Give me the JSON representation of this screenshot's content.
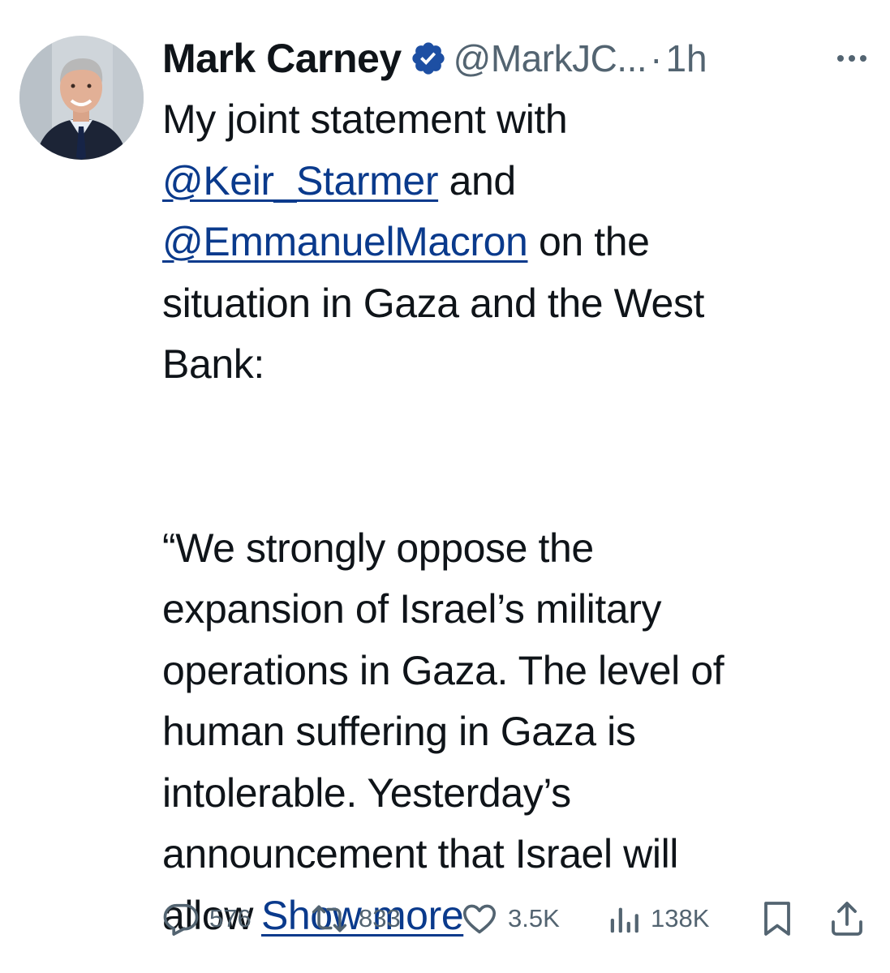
{
  "tweet": {
    "author": {
      "display_name": "Mark Carney",
      "handle": "@MarkJC...",
      "verified": true
    },
    "separator": "·",
    "time": "1h",
    "text": {
      "line1": "My joint statement with",
      "mention1": "@Keir_Starmer",
      "after_mention1": " and",
      "mention2": "@EmmanuelMacron",
      "after_mention2": " on the",
      "line4": "situation in Gaza and the West",
      "line5": "Bank:",
      "quote_lines": [
        "“We strongly oppose the",
        "expansion of Israel’s military",
        "operations in Gaza. The level of",
        "human suffering in Gaza is",
        "intolerable. Yesterday’s",
        "announcement that Israel will"
      ],
      "last_line_start": "allow",
      "show_more": "Show more"
    },
    "actions": {
      "replies": "576",
      "reposts": "833",
      "likes": "3.5K",
      "views": "138K"
    },
    "icons": {
      "verified": "verified-badge-icon",
      "more": "more-options-icon",
      "reply": "reply-icon",
      "repost": "repost-icon",
      "like": "heart-icon",
      "views": "views-chart-icon",
      "bookmark": "bookmark-icon",
      "share": "share-icon"
    },
    "colors": {
      "text": "#0f1419",
      "secondary": "#536471",
      "link": "#0a3a8c",
      "verified": "#1d4fa3"
    }
  }
}
